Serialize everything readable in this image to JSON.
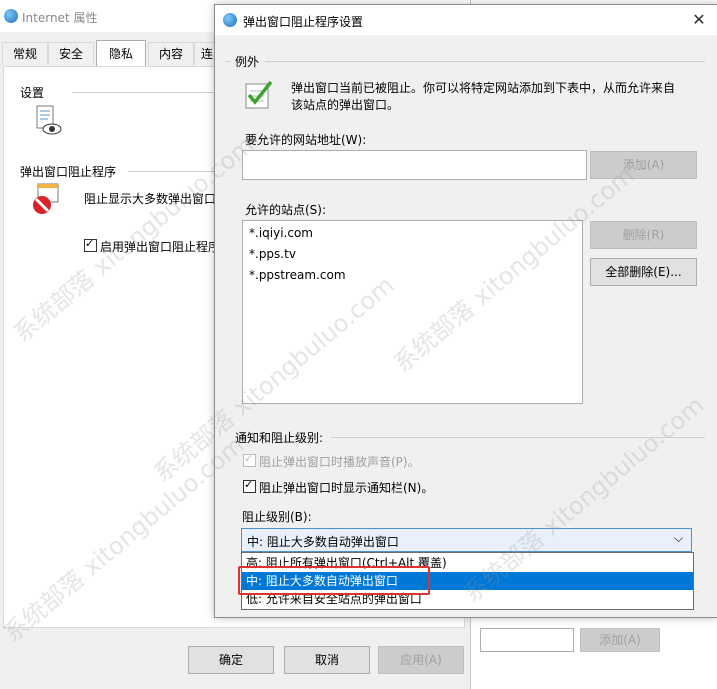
{
  "bg_window": {
    "title": "Internet 属性",
    "tabs": [
      "常规",
      "安全",
      "隐私",
      "内容",
      "连"
    ],
    "active_tab": "隐私",
    "settings_label": "设置",
    "popup_group_label": "弹出窗口阻止程序",
    "popup_desc": "阻止显示大多数弹出窗口",
    "enable_popup_label": "启用弹出窗口阻止程序",
    "buttons": {
      "ok": "确定",
      "cancel": "取消",
      "apply": "应用(A)"
    },
    "right_add_button": "添加(A)"
  },
  "dialog": {
    "title": "弹出窗口阻止程序设置",
    "close_glyph": "✕",
    "exceptions_group": "例外",
    "exceptions_desc_line1": "弹出窗口当前已被阻止。你可以将特定网站添加到下表中，从而允许来自",
    "exceptions_desc_line2": "该站点的弹出窗口。",
    "address_label": "要允许的网站地址(W):",
    "address_value": "",
    "add_button": "添加(A)",
    "allowed_label": "允许的站点(S):",
    "allowed_sites": [
      "*.iqiyi.com",
      "*.pps.tv",
      "*.ppstream.com"
    ],
    "remove_button": "删除(R)",
    "remove_all_button": "全部删除(E)...",
    "notify_group": "通知和阻止级别:",
    "play_sound_label": "阻止弹出窗口时播放声音(P)。",
    "show_bar_label": "阻止弹出窗口时显示通知栏(N)。",
    "block_level_label": "阻止级别(B):",
    "block_level_selected": "中: 阻止大多数自动弹出窗口",
    "block_level_options": [
      "高: 阻止所有弹出窗口(Ctrl+Alt 覆盖)",
      "中: 阻止大多数自动弹出窗口",
      "低: 允许来自安全站点的弹出窗口"
    ],
    "chevron_glyph": "⌵"
  },
  "watermark": "系统部落 xitongbuluo.com"
}
